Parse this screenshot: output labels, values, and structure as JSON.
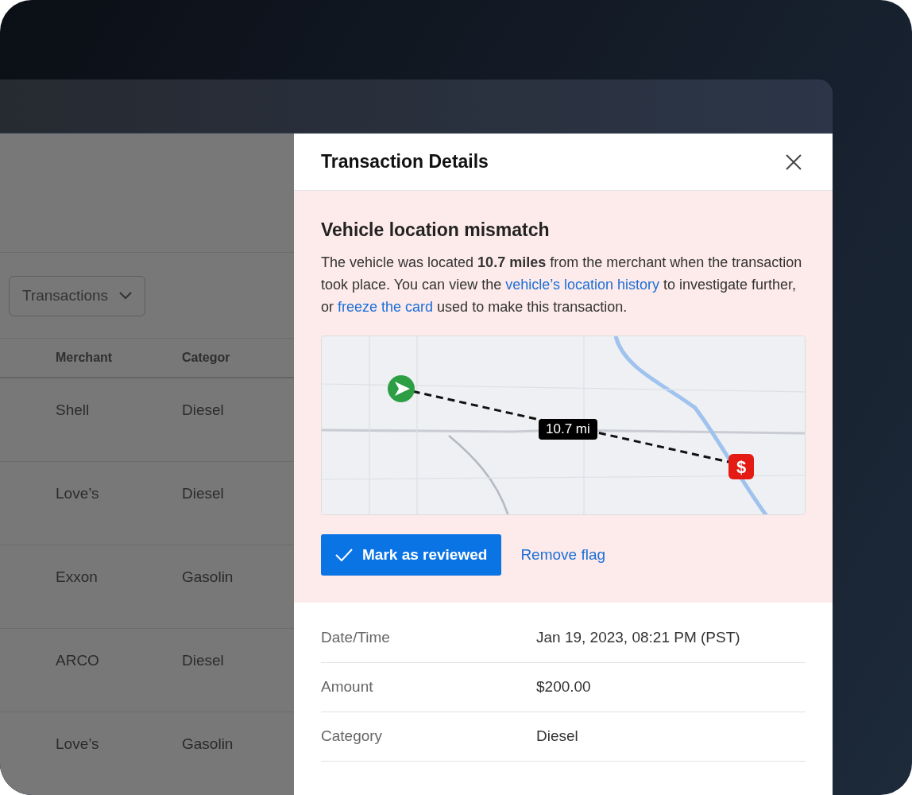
{
  "background_page": {
    "view_dropdown": {
      "label": "Transactions"
    },
    "table": {
      "columns": [
        "Merchant",
        "Categor"
      ],
      "rows": [
        [
          "Shell",
          "Diesel"
        ],
        [
          "Love’s",
          "Diesel"
        ],
        [
          "Exxon",
          "Gasolin"
        ],
        [
          "ARCO",
          "Diesel"
        ],
        [
          "Love’s",
          "Gasolin"
        ]
      ]
    }
  },
  "drawer": {
    "title": "Transaction Details",
    "alert": {
      "heading": "Vehicle location mismatch",
      "message": [
        {
          "kind": "text",
          "text": "The vehicle was located **10.7 miles** from the merchant when the transaction took place. You can view the "
        },
        {
          "kind": "link",
          "text": "vehicle’s location history"
        },
        {
          "kind": "text",
          "text": " to investigate further, or "
        },
        {
          "kind": "link",
          "text": "freeze the card"
        },
        {
          "kind": "text",
          "text": " used to make this transaction."
        }
      ],
      "map": {
        "merchant_marker": "$",
        "distance_label": "10.7 mi"
      },
      "primary_button": "Mark as reviewed",
      "secondary_link": "Remove flag"
    },
    "details": [
      {
        "label": "Date/Time",
        "value": "Jan 19, 2023, 08:21 PM (PST)"
      },
      {
        "label": "Amount",
        "value": "$200.00"
      },
      {
        "label": "Category",
        "value": "Diesel"
      }
    ]
  }
}
